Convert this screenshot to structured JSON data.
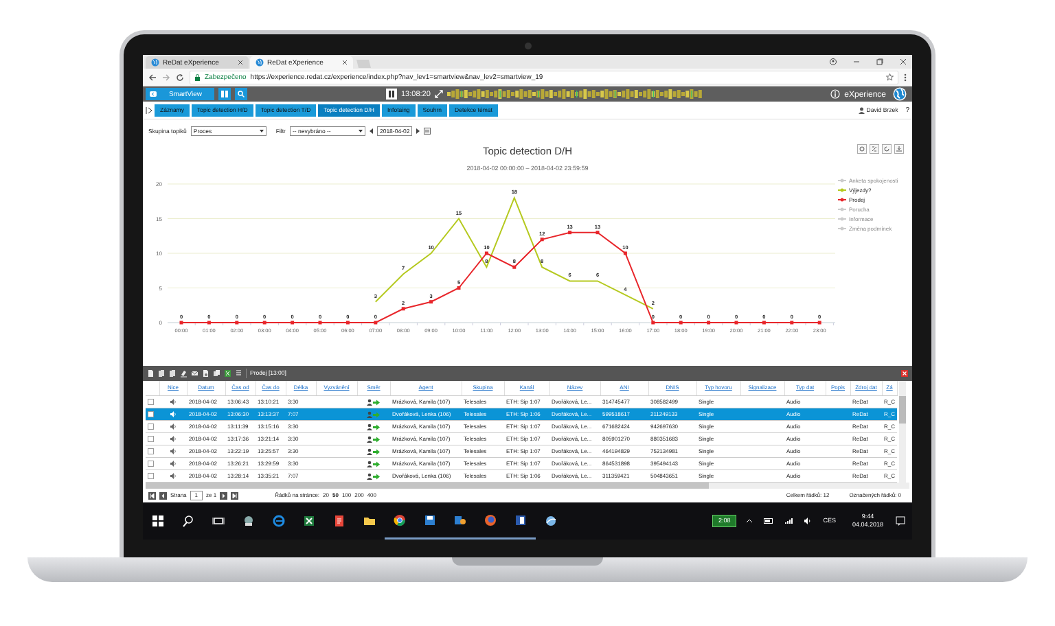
{
  "browser": {
    "tabs": [
      {
        "title": "ReDat eXperience",
        "selected": false
      },
      {
        "title": "ReDat eXperience",
        "selected": true
      }
    ],
    "security": "Zabezpečeno",
    "url": "https://experience.redat.cz/experience/index.php?nav_lev1=smartview&nav_lev2=smartview_19"
  },
  "app_header": {
    "view_button": "SmartView",
    "time": "13:08:20",
    "brand": "eXperience"
  },
  "nav_tabs": [
    {
      "label": "Záznamy",
      "selected": false
    },
    {
      "label": "Topic detection H/D",
      "selected": false
    },
    {
      "label": "Topic detection T/D",
      "selected": false
    },
    {
      "label": "Topic detection D/H",
      "selected": true
    },
    {
      "label": "Infotaing",
      "selected": false
    },
    {
      "label": "Souhrn",
      "selected": false
    },
    {
      "label": "Detekce témat",
      "selected": false
    }
  ],
  "user": "David Brzek",
  "help": "?",
  "filters": {
    "group_label": "Skupina topiků",
    "group_value": "Proces",
    "filter_label": "Filtr",
    "filter_value": "-- nevybráno --",
    "date": "2018-04-02"
  },
  "chart": {
    "title": "Topic detection D/H",
    "subtitle": "2018-04-02 00:00:00 – 2018-04-02 23:59:59",
    "legend": [
      {
        "kind": "hidden",
        "label": "Anketa spokojenosti"
      },
      {
        "kind": "series"
      },
      {
        "kind": "series"
      },
      {
        "kind": "hidden",
        "label": "Porucha"
      },
      {
        "kind": "hidden",
        "label": "Informace"
      },
      {
        "kind": "hidden",
        "label": "Změna podmínek"
      }
    ],
    "chart_data": {
      "type": "line",
      "grid": true,
      "legend": "right",
      "categories": [
        "00:00",
        "01:00",
        "02:00",
        "03:00",
        "04:00",
        "05:00",
        "06:00",
        "07:00",
        "08:00",
        "09:00",
        "10:00",
        "11:00",
        "12:00",
        "13:00",
        "14:00",
        "15:00",
        "16:00",
        "17:00",
        "18:00",
        "19:00",
        "20:00",
        "21:00",
        "22:00",
        "23:00"
      ],
      "ylim": [
        0,
        20
      ],
      "yticks": [
        0,
        5,
        10,
        15,
        20
      ],
      "data_labels": true,
      "series": [
        {
          "name": "Výjezdy?",
          "color": "#b5c91f",
          "marker": "none",
          "values": [
            null,
            null,
            null,
            null,
            null,
            null,
            null,
            3,
            7,
            10,
            15,
            8,
            18,
            8,
            6,
            6,
            4,
            2,
            null,
            null,
            null,
            null,
            null,
            null
          ]
        },
        {
          "name": "Prodej",
          "color": "#e8262b",
          "marker": "square",
          "values": [
            0,
            0,
            0,
            0,
            0,
            0,
            0,
            0,
            2,
            3,
            5,
            10,
            8,
            12,
            13,
            13,
            10,
            0,
            0,
            0,
            0,
            0,
            0,
            0
          ]
        }
      ]
    }
  },
  "grid": {
    "title": "Prodej [13:00]",
    "columns": [
      {
        "label": "Nice",
        "kind": "speaker"
      },
      {
        "label": "Datum",
        "kind": "text"
      },
      {
        "label": "Čas od",
        "kind": "text"
      },
      {
        "label": "Čas do",
        "kind": "text"
      },
      {
        "label": "Délka",
        "kind": "text"
      },
      {
        "label": "Vyzvánění",
        "kind": "empty"
      },
      {
        "label": "Směr",
        "kind": "direction"
      },
      {
        "label": "Agent",
        "kind": "text"
      },
      {
        "label": "Skupina",
        "kind": "text"
      },
      {
        "label": "Kanál",
        "kind": "text"
      },
      {
        "label": "Název",
        "kind": "text"
      },
      {
        "label": "ANI",
        "kind": "text"
      },
      {
        "label": "DNIS",
        "kind": "text"
      },
      {
        "label": "Typ hovoru",
        "kind": "text"
      },
      {
        "label": "Signalizace",
        "kind": "empty"
      },
      {
        "label": "Typ dat",
        "kind": "text"
      },
      {
        "label": "Popis",
        "kind": "empty"
      },
      {
        "label": "Zdroj dat",
        "kind": "text"
      },
      {
        "label": "Zá",
        "kind": "text"
      }
    ],
    "rows": [
      {
        "selected": false,
        "checked": false,
        "cells": [
          "",
          "2018-04-02",
          "13:06:43",
          "13:10:21",
          "3:30",
          "",
          "",
          "Mrázková, Kamila (107)",
          "Telesales",
          "ETH: Sip 1:07",
          "Dvořáková, Le...",
          "314745477",
          "308582499",
          "Single",
          "",
          "Audio",
          "",
          "ReDat",
          "R_C"
        ]
      },
      {
        "selected": true,
        "checked": false,
        "cells": [
          "",
          "2018-04-02",
          "13:06:30",
          "13:13:37",
          "7:07",
          "",
          "",
          "Dvořáková, Lenka (106)",
          "Telesales",
          "ETH: Sip 1:06",
          "Dvořáková, Le...",
          "599518617",
          "211249133",
          "Single",
          "",
          "Audio",
          "",
          "ReDat",
          "R_C"
        ]
      },
      {
        "selected": false,
        "checked": false,
        "cells": [
          "",
          "2018-04-02",
          "13:11:39",
          "13:15:16",
          "3:30",
          "",
          "",
          "Mrázková, Kamila (107)",
          "Telesales",
          "ETH: Sip 1:07",
          "Dvořáková, Le...",
          "671682424",
          "942697630",
          "Single",
          "",
          "Audio",
          "",
          "ReDat",
          "R_C"
        ]
      },
      {
        "selected": false,
        "checked": false,
        "cells": [
          "",
          "2018-04-02",
          "13:17:36",
          "13:21:14",
          "3:30",
          "",
          "",
          "Mrázková, Kamila (107)",
          "Telesales",
          "ETH: Sip 1:07",
          "Dvořáková, Le...",
          "805901270",
          "880351683",
          "Single",
          "",
          "Audio",
          "",
          "ReDat",
          "R_C"
        ]
      },
      {
        "selected": false,
        "checked": false,
        "cells": [
          "",
          "2018-04-02",
          "13:22:19",
          "13:25:57",
          "3:30",
          "",
          "",
          "Mrázková, Kamila (107)",
          "Telesales",
          "ETH: Sip 1:07",
          "Dvořáková, Le...",
          "464194829",
          "752134981",
          "Single",
          "",
          "Audio",
          "",
          "ReDat",
          "R_C"
        ]
      },
      {
        "selected": false,
        "checked": false,
        "cells": [
          "",
          "2018-04-02",
          "13:26:21",
          "13:29:59",
          "3:30",
          "",
          "",
          "Mrázková, Kamila (107)",
          "Telesales",
          "ETH: Sip 1:07",
          "Dvořáková, Le...",
          "864531898",
          "395494143",
          "Single",
          "",
          "Audio",
          "",
          "ReDat",
          "R_C"
        ]
      },
      {
        "selected": false,
        "checked": false,
        "cells": [
          "",
          "2018-04-02",
          "13:28:14",
          "13:35:21",
          "7:07",
          "",
          "",
          "Dvořáková, Lenka (106)",
          "Telesales",
          "ETH: Sip 1:06",
          "Dvořáková, Le...",
          "311359421",
          "504843651",
          "Single",
          "",
          "Audio",
          "",
          "ReDat",
          "R_C"
        ]
      }
    ]
  },
  "pager": {
    "page_label": "Strana",
    "page": "1",
    "of": "ze 1",
    "rows_label": "Řádků na stránce:",
    "page_sizes": [
      {
        "label": "20",
        "selected": false
      },
      {
        "label": "50",
        "selected": true
      },
      {
        "label": "100",
        "selected": false
      },
      {
        "label": "200",
        "selected": false
      },
      {
        "label": "400",
        "selected": false
      }
    ],
    "total": "Celkem řádků: 12",
    "marked": "Označených řádků: 0"
  },
  "taskbar": {
    "meter": "2:08",
    "language": "CES",
    "time": "9:44",
    "date": "04.04.2018"
  }
}
